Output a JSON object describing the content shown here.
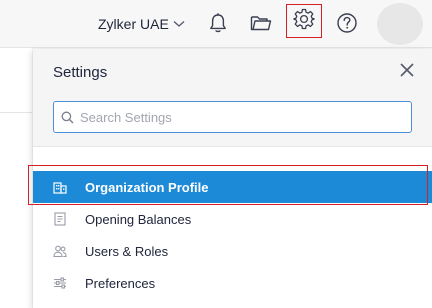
{
  "topbar": {
    "org_name": "Zylker UAE",
    "icons": [
      "bell-icon",
      "folder-icon",
      "gear-icon",
      "help-icon"
    ]
  },
  "settings_panel": {
    "title": "Settings",
    "search_placeholder": "Search Settings",
    "search_value": "",
    "items": [
      {
        "label": "Organization Profile",
        "icon": "building-icon",
        "active": true
      },
      {
        "label": "Opening Balances",
        "icon": "ledger-icon",
        "active": false
      },
      {
        "label": "Users & Roles",
        "icon": "users-icon",
        "active": false
      },
      {
        "label": "Preferences",
        "icon": "sliders-icon",
        "active": false
      }
    ]
  },
  "colors": {
    "accent": "#1d8ad8",
    "highlight_outline": "#d31f26",
    "search_border": "#4d8fd6"
  }
}
